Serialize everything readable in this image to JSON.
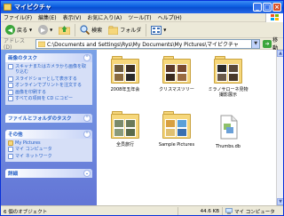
{
  "window": {
    "title": "マイピクチャ"
  },
  "menu": [
    "ファイル(F)",
    "編集(E)",
    "表示(V)",
    "お気に入り(A)",
    "ツール(T)",
    "ヘルプ(H)"
  ],
  "toolbar": {
    "back": "戻る",
    "search": "検索",
    "folders": "フォルダ"
  },
  "address": {
    "label": "アドレス(D)",
    "path": "C:\\Documents and Settings\\Rys\\My Documents\\My Pictures\\マイピクチャ",
    "go": "移動"
  },
  "tasks": {
    "picture": {
      "title": "画像のタスク",
      "items": [
        "スキャナまたはカメラから画像を取り込む",
        "スライドショーとして表示する",
        "オンラインでプリントを注文する",
        "画像を印刷する",
        "すべての項目を CD にコピー"
      ]
    },
    "file": {
      "title": "ファイルとフォルダのタスク"
    },
    "other": {
      "title": "その他",
      "items": [
        "My Pictures",
        "マイ コンピュータ",
        "マイ ネットワーク"
      ]
    },
    "details": {
      "title": "詳細"
    }
  },
  "files": [
    {
      "name": "2008年五年会",
      "type": "folder"
    },
    {
      "name": "クリスマスツリー",
      "type": "folder"
    },
    {
      "name": "ミラノサローネ見物撮影展示",
      "type": "folder"
    },
    {
      "name": "全员旅行",
      "type": "folder"
    },
    {
      "name": "Sample Pictures",
      "type": "folder"
    },
    {
      "name": "Thumbs.db",
      "type": "file"
    }
  ],
  "status": {
    "objects": "6 個のオブジェクト",
    "size": "44.6 KB",
    "location": "マイ コンピュータ"
  }
}
